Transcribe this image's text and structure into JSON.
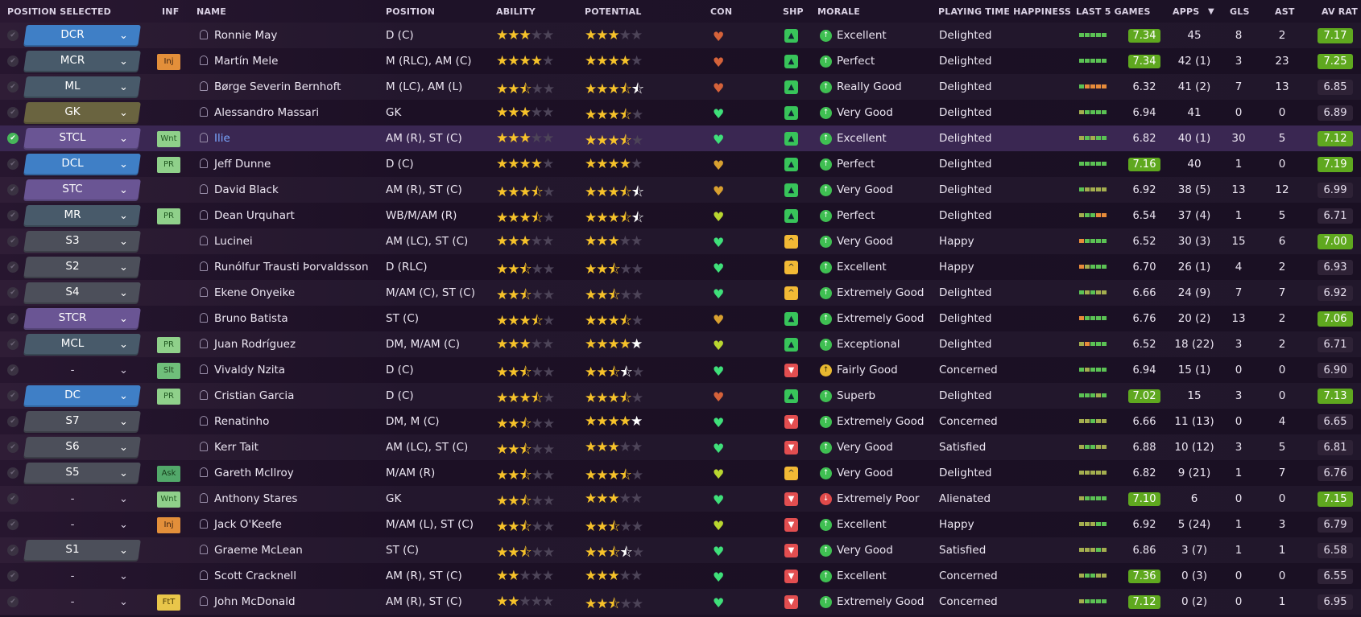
{
  "header": {
    "position_selected": "POSITION SELECTED",
    "inf": "INF",
    "name": "NAME",
    "position": "POSITION",
    "ability": "ABILITY",
    "potential": "POTENTIAL",
    "con": "CON",
    "shp": "SHP",
    "morale": "MORALE",
    "playing_time": "PLAYING TIME HAPPINESS",
    "last5": "LAST 5 GAMES",
    "apps": "APPS",
    "sort_indicator": "▼",
    "gls": "GLS",
    "ast": "AST",
    "av_rat": "AV RAT"
  },
  "players": [
    {
      "selected": false,
      "slot": "DCR",
      "slot_color": "#3f7fc6",
      "inf": "",
      "name": "Ronnie May",
      "position": "D (C)",
      "ability": 3,
      "potential": 3,
      "condition": "low",
      "happiness": "up",
      "morale_icon": "g",
      "morale": "Excellent",
      "playing_time": "Delighted",
      "form": [
        "g",
        "g",
        "g",
        "g",
        "g"
      ],
      "form_avg": "7.34",
      "form_high": true,
      "apps": "45",
      "gls": "8",
      "ast": "2",
      "av_rat": "7.17",
      "av_good": true
    },
    {
      "selected": false,
      "slot": "MCR",
      "slot_color": "#485a6a",
      "inf": "Inj",
      "name": "Martín Mele",
      "position": "M (RLC), AM (C)",
      "ability": 4,
      "potential": 4,
      "condition": "low",
      "happiness": "up",
      "morale_icon": "g",
      "morale": "Perfect",
      "playing_time": "Delighted",
      "form": [
        "g",
        "g",
        "g",
        "g",
        "g"
      ],
      "form_avg": "7.34",
      "form_high": true,
      "apps": "42 (1)",
      "gls": "3",
      "ast": "23",
      "av_rat": "7.25",
      "av_good": true
    },
    {
      "selected": false,
      "slot": "ML",
      "slot_color": "#485a6a",
      "inf": "",
      "name": "Børge Severin Bernhoft",
      "position": "M (LC), AM (L)",
      "ability": 2.5,
      "potential": 3.5,
      "potential_extra": 0.5,
      "condition": "low",
      "happiness": "up",
      "morale_icon": "g",
      "morale": "Really Good",
      "playing_time": "Delighted",
      "form": [
        "g",
        "o",
        "o",
        "o",
        "o"
      ],
      "form_avg": "6.32",
      "form_high": false,
      "apps": "41 (2)",
      "gls": "7",
      "ast": "13",
      "av_rat": "6.85",
      "av_good": false
    },
    {
      "selected": false,
      "slot": "GK",
      "slot_color": "#6a6440",
      "inf": "",
      "name": "Alessandro Massari",
      "position": "GK",
      "ability": 3,
      "potential": 3.5,
      "condition": "ok",
      "happiness": "up",
      "morale_icon": "g",
      "morale": "Very Good",
      "playing_time": "Delighted",
      "form": [
        "y",
        "g",
        "g",
        "g",
        "g"
      ],
      "form_avg": "6.94",
      "form_high": false,
      "apps": "41",
      "gls": "0",
      "ast": "0",
      "av_rat": "6.89",
      "av_good": false
    },
    {
      "selected": true,
      "slot": "STCL",
      "slot_color": "#6a5594",
      "inf": "Wnt",
      "name": "Ilie",
      "position": "AM (R), ST (C)",
      "ability": 3,
      "potential": 3.5,
      "condition": "ok",
      "happiness": "up",
      "morale_icon": "g",
      "morale": "Excellent",
      "playing_time": "Delighted",
      "form": [
        "y",
        "g",
        "y",
        "g",
        "g"
      ],
      "form_avg": "6.82",
      "form_high": false,
      "apps": "40 (1)",
      "gls": "30",
      "ast": "5",
      "av_rat": "7.12",
      "av_good": true
    },
    {
      "selected": false,
      "slot": "DCL",
      "slot_color": "#3f7fc6",
      "inf": "PR",
      "name": "Jeff Dunne",
      "position": "D (C)",
      "ability": 4,
      "potential": 4,
      "condition": "warn",
      "happiness": "up",
      "morale_icon": "g",
      "morale": "Perfect",
      "playing_time": "Delighted",
      "form": [
        "g",
        "g",
        "g",
        "g",
        "g"
      ],
      "form_avg": "7.16",
      "form_high": true,
      "apps": "40",
      "gls": "1",
      "ast": "0",
      "av_rat": "7.19",
      "av_good": true
    },
    {
      "selected": false,
      "slot": "STC",
      "slot_color": "#6a5594",
      "inf": "",
      "name": "David Black",
      "position": "AM (R), ST (C)",
      "ability": 3.5,
      "potential": 3.5,
      "potential_extra": 0.5,
      "condition": "warn",
      "happiness": "up",
      "morale_icon": "g",
      "morale": "Very Good",
      "playing_time": "Delighted",
      "form": [
        "g",
        "y",
        "y",
        "y",
        "y"
      ],
      "form_avg": "6.92",
      "form_high": false,
      "apps": "38 (5)",
      "gls": "13",
      "ast": "12",
      "av_rat": "6.99",
      "av_good": false
    },
    {
      "selected": false,
      "slot": "MR",
      "slot_color": "#485a6a",
      "inf": "PR",
      "name": "Dean Urquhart",
      "position": "WB/M/AM (R)",
      "ability": 3.5,
      "potential": 3.5,
      "potential_extra": 0.5,
      "condition": "mid",
      "happiness": "up",
      "morale_icon": "g",
      "morale": "Perfect",
      "playing_time": "Delighted",
      "form": [
        "y",
        "g",
        "g",
        "o",
        "o"
      ],
      "form_avg": "6.54",
      "form_high": false,
      "apps": "37 (4)",
      "gls": "1",
      "ast": "5",
      "av_rat": "6.71",
      "av_good": false
    },
    {
      "selected": false,
      "slot": "S3",
      "slot_color": "#4c4f5a",
      "inf": "",
      "name": "Lucinei",
      "position": "AM (LC), ST (C)",
      "ability": 3,
      "potential": 3,
      "condition": "ok",
      "happiness": "mid",
      "morale_icon": "g",
      "morale": "Very Good",
      "playing_time": "Happy",
      "form": [
        "o",
        "g",
        "g",
        "g",
        "g"
      ],
      "form_avg": "6.52",
      "form_high": false,
      "apps": "30 (3)",
      "gls": "15",
      "ast": "6",
      "av_rat": "7.00",
      "av_good": true
    },
    {
      "selected": false,
      "slot": "S2",
      "slot_color": "#4c4f5a",
      "inf": "",
      "name": "Runólfur Trausti Þorvaldsson",
      "position": "D (RLC)",
      "ability": 2.5,
      "potential": 2.5,
      "condition": "ok",
      "happiness": "mid",
      "morale_icon": "g",
      "morale": "Excellent",
      "playing_time": "Happy",
      "form": [
        "o",
        "y",
        "g",
        "g",
        "g"
      ],
      "form_avg": "6.70",
      "form_high": false,
      "apps": "26 (1)",
      "gls": "4",
      "ast": "2",
      "av_rat": "6.93",
      "av_good": false
    },
    {
      "selected": false,
      "slot": "S4",
      "slot_color": "#4c4f5a",
      "inf": "",
      "name": "Ekene Onyeike",
      "position": "M/AM (C), ST (C)",
      "ability": 2.5,
      "potential": 2.5,
      "condition": "ok",
      "happiness": "mid",
      "morale_icon": "g",
      "morale": "Extremely Good",
      "playing_time": "Delighted",
      "form": [
        "g",
        "y",
        "g",
        "y",
        "y"
      ],
      "form_avg": "6.66",
      "form_high": false,
      "apps": "24 (9)",
      "gls": "7",
      "ast": "7",
      "av_rat": "6.92",
      "av_good": false
    },
    {
      "selected": false,
      "slot": "STCR",
      "slot_color": "#6a5594",
      "inf": "",
      "name": "Bruno Batista",
      "position": "ST (C)",
      "ability": 3.5,
      "potential": 3.5,
      "condition": "warn",
      "happiness": "up",
      "morale_icon": "g",
      "morale": "Extremely Good",
      "playing_time": "Delighted",
      "form": [
        "o",
        "g",
        "g",
        "g",
        "g"
      ],
      "form_avg": "6.76",
      "form_high": false,
      "apps": "20 (2)",
      "gls": "13",
      "ast": "2",
      "av_rat": "7.06",
      "av_good": true
    },
    {
      "selected": false,
      "slot": "MCL",
      "slot_color": "#485a6a",
      "inf": "PR",
      "name": "Juan Rodríguez",
      "position": "DM, M/AM (C)",
      "ability": 3,
      "potential": 4,
      "potential_extra": 1,
      "condition": "mid",
      "happiness": "up",
      "morale_icon": "g",
      "morale": "Exceptional",
      "playing_time": "Delighted",
      "form": [
        "y",
        "o",
        "g",
        "g",
        "g"
      ],
      "form_avg": "6.52",
      "form_high": false,
      "apps": "18 (22)",
      "gls": "3",
      "ast": "2",
      "av_rat": "6.71",
      "av_good": false
    },
    {
      "selected": false,
      "slot": "-",
      "slot_color": "",
      "inf": "Slt",
      "name": "Vivaldy Nzita",
      "position": "D (C)",
      "ability": 2.5,
      "potential": 2.5,
      "potential_extra": 0.5,
      "condition": "ok",
      "happiness": "down",
      "morale_icon": "y",
      "morale": "Fairly Good",
      "playing_time": "Concerned",
      "form": [
        "g",
        "y",
        "g",
        "g",
        "g"
      ],
      "form_avg": "6.94",
      "form_high": false,
      "apps": "15 (1)",
      "gls": "0",
      "ast": "0",
      "av_rat": "6.90",
      "av_good": false
    },
    {
      "selected": false,
      "slot": "DC",
      "slot_color": "#3f7fc6",
      "inf": "PR",
      "name": "Cristian Garcia",
      "position": "D (C)",
      "ability": 3.5,
      "potential": 3.5,
      "condition": "low",
      "happiness": "up",
      "morale_icon": "g",
      "morale": "Superb",
      "playing_time": "Delighted",
      "form": [
        "g",
        "g",
        "g",
        "y",
        "g"
      ],
      "form_avg": "7.02",
      "form_high": true,
      "apps": "15",
      "gls": "3",
      "ast": "0",
      "av_rat": "7.13",
      "av_good": true
    },
    {
      "selected": false,
      "slot": "S7",
      "slot_color": "#4c4f5a",
      "inf": "",
      "name": "Renatinho",
      "position": "DM, M (C)",
      "ability": 2.5,
      "potential": 4,
      "potential_extra": 1,
      "condition": "ok",
      "happiness": "down",
      "morale_icon": "g",
      "morale": "Extremely Good",
      "playing_time": "Concerned",
      "form": [
        "y",
        "y",
        "g",
        "y",
        "y"
      ],
      "form_avg": "6.66",
      "form_high": false,
      "apps": "11 (13)",
      "gls": "0",
      "ast": "4",
      "av_rat": "6.65",
      "av_good": false
    },
    {
      "selected": false,
      "slot": "S6",
      "slot_color": "#4c4f5a",
      "inf": "",
      "name": "Kerr Tait",
      "position": "AM (LC), ST (C)",
      "ability": 2.5,
      "potential": 3,
      "condition": "ok",
      "happiness": "down",
      "morale_icon": "g",
      "morale": "Very Good",
      "playing_time": "Satisfied",
      "form": [
        "y",
        "g",
        "g",
        "y",
        "y"
      ],
      "form_avg": "6.88",
      "form_high": false,
      "apps": "10 (12)",
      "gls": "3",
      "ast": "5",
      "av_rat": "6.81",
      "av_good": false
    },
    {
      "selected": false,
      "slot": "S5",
      "slot_color": "#4c4f5a",
      "inf": "Ask",
      "name": "Gareth McIlroy",
      "position": "M/AM (R)",
      "ability": 2.5,
      "potential": 3.5,
      "condition": "mid",
      "happiness": "mid",
      "morale_icon": "g",
      "morale": "Very Good",
      "playing_time": "Delighted",
      "form": [
        "y",
        "y",
        "y",
        "y",
        "y"
      ],
      "form_avg": "6.82",
      "form_high": false,
      "apps": "9 (21)",
      "gls": "1",
      "ast": "7",
      "av_rat": "6.76",
      "av_good": false
    },
    {
      "selected": false,
      "slot": "-",
      "slot_color": "",
      "inf": "Wnt",
      "name": "Anthony Stares",
      "position": "GK",
      "ability": 2.5,
      "potential": 3,
      "condition": "ok",
      "happiness": "down",
      "morale_icon": "r",
      "morale": "Extremely Poor",
      "playing_time": "Alienated",
      "form": [
        "y",
        "g",
        "g",
        "g",
        "g"
      ],
      "form_avg": "7.10",
      "form_high": true,
      "apps": "6",
      "gls": "0",
      "ast": "0",
      "av_rat": "7.15",
      "av_good": true
    },
    {
      "selected": false,
      "slot": "-",
      "slot_color": "",
      "inf": "Inj",
      "name": "Jack O'Keefe",
      "position": "M/AM (L), ST (C)",
      "ability": 2.5,
      "potential": 2.5,
      "condition": "mid",
      "happiness": "down",
      "morale_icon": "g",
      "morale": "Excellent",
      "playing_time": "Happy",
      "form": [
        "y",
        "y",
        "y",
        "g",
        "g"
      ],
      "form_avg": "6.92",
      "form_high": false,
      "apps": "5 (24)",
      "gls": "1",
      "ast": "3",
      "av_rat": "6.79",
      "av_good": false
    },
    {
      "selected": false,
      "slot": "S1",
      "slot_color": "#4c4f5a",
      "inf": "",
      "name": "Graeme McLean",
      "position": "ST (C)",
      "ability": 2.5,
      "potential": 2.5,
      "potential_extra": 0.5,
      "condition": "ok",
      "happiness": "down",
      "morale_icon": "g",
      "morale": "Very Good",
      "playing_time": "Satisfied",
      "form": [
        "y",
        "y",
        "y",
        "g",
        "y"
      ],
      "form_avg": "6.86",
      "form_high": false,
      "apps": "3 (7)",
      "gls": "1",
      "ast": "1",
      "av_rat": "6.58",
      "av_good": false
    },
    {
      "selected": false,
      "slot": "-",
      "slot_color": "",
      "inf": "",
      "name": "Scott Cracknell",
      "position": "AM (R), ST (C)",
      "ability": 2,
      "potential": 3,
      "condition": "ok",
      "happiness": "down",
      "morale_icon": "g",
      "morale": "Excellent",
      "playing_time": "Concerned",
      "form": [
        "y",
        "g",
        "g",
        "y",
        "y"
      ],
      "form_avg": "7.36",
      "form_high": true,
      "apps": "0 (3)",
      "gls": "0",
      "ast": "0",
      "av_rat": "6.55",
      "av_good": false
    },
    {
      "selected": false,
      "slot": "-",
      "slot_color": "",
      "inf": "FtT",
      "name": "John McDonald",
      "position": "AM (R), ST (C)",
      "ability": 2,
      "potential": 2.5,
      "condition": "ok",
      "happiness": "down",
      "morale_icon": "g",
      "morale": "Extremely Good",
      "playing_time": "Concerned",
      "form": [
        "y",
        "g",
        "g",
        "g",
        "g"
      ],
      "form_avg": "7.12",
      "form_high": true,
      "apps": "0 (2)",
      "gls": "0",
      "ast": "1",
      "av_rat": "6.95",
      "av_good": false
    }
  ]
}
